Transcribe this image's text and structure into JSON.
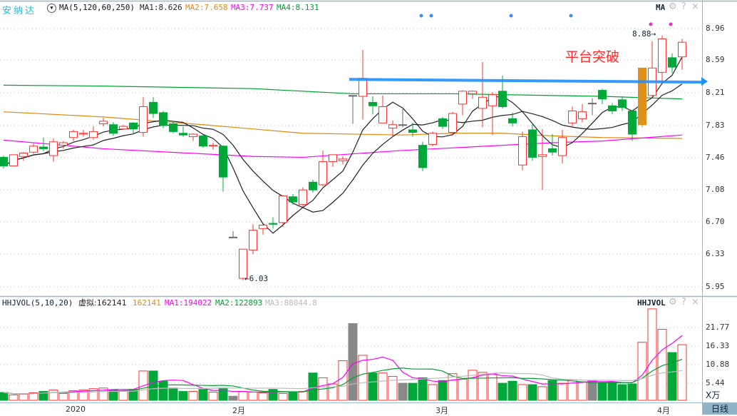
{
  "header": {
    "stock_name": "安纳达",
    "ma_params": "MA(5,120,60,250)",
    "ma1": "MA1:8.626",
    "ma2": "MA2:7.658",
    "ma3": "MA3:7.737",
    "ma4": "MA4:8.131",
    "indicator_name": "MA"
  },
  "volume_header": {
    "params": "HHJVOL(5,10,20)",
    "virtual": "虚拟:162141",
    "value": "162141",
    "ma1": "MA1:194022",
    "ma2": "MA2:122893",
    "ma3": "MA3:88044.8",
    "indicator_name": "HHJVOL",
    "unit": "X万"
  },
  "icons": {
    "settings": "gear-icon",
    "help": "?",
    "close": "×",
    "dropdown": "▼"
  },
  "annotation": "平台突破",
  "high_label": "8.88→",
  "low_label": "←6.03",
  "price_axis": [
    "8.96",
    "8.59",
    "8.21",
    "7.83",
    "7.46",
    "7.08",
    "6.70",
    "6.33",
    "5.95"
  ],
  "volume_axis": [
    "21.77",
    "16.33",
    "10.88",
    "5.44"
  ],
  "x_axis": [
    "2020",
    "2月",
    "3月",
    "4月"
  ],
  "period_button": "日线",
  "colors": {
    "up": "#ff3232",
    "down": "#00a83a",
    "ma1": "#222222",
    "ma2": "#e08a10",
    "ma3": "#ff00ff",
    "ma4": "#00a030",
    "arrow": "#1e90ff",
    "highlight": "#e0901a"
  },
  "chart_data": {
    "type": "candlestick",
    "ohlc": [
      [
        7.46,
        7.36,
        7.48,
        7.33
      ],
      [
        7.36,
        7.49,
        7.49,
        7.36
      ],
      [
        7.47,
        7.51,
        7.52,
        7.42
      ],
      [
        7.52,
        7.59,
        7.62,
        7.5
      ],
      [
        7.58,
        7.56,
        7.69,
        7.53
      ],
      [
        7.48,
        7.64,
        7.68,
        7.41
      ],
      [
        7.6,
        7.63,
        7.65,
        7.56
      ],
      [
        7.69,
        7.76,
        7.78,
        7.65
      ],
      [
        7.73,
        7.74,
        7.78,
        7.7
      ],
      [
        7.69,
        7.76,
        7.82,
        7.66
      ],
      [
        7.85,
        7.88,
        7.92,
        7.82
      ],
      [
        7.84,
        7.74,
        7.87,
        7.71
      ],
      [
        7.79,
        7.82,
        7.84,
        7.78
      ],
      [
        7.86,
        7.79,
        7.87,
        7.73
      ],
      [
        7.75,
        8.05,
        8.16,
        7.7
      ],
      [
        8.1,
        7.97,
        8.16,
        7.92
      ],
      [
        7.98,
        7.83,
        8.0,
        7.8
      ],
      [
        7.85,
        7.76,
        7.88,
        7.74
      ],
      [
        7.74,
        7.72,
        7.82,
        7.7
      ],
      [
        7.7,
        7.73,
        7.74,
        7.65
      ],
      [
        7.71,
        7.59,
        7.72,
        7.57
      ],
      [
        7.59,
        7.6,
        7.63,
        7.55
      ],
      [
        7.59,
        7.23,
        7.6,
        7.06
      ],
      [
        6.53,
        6.53,
        6.6,
        6.53
      ],
      [
        6.05,
        6.39,
        6.39,
        6.03
      ],
      [
        6.38,
        6.61,
        6.68,
        6.33
      ],
      [
        6.63,
        6.67,
        6.68,
        6.56
      ],
      [
        6.69,
        6.68,
        6.76,
        6.63
      ],
      [
        6.7,
        7.01,
        7.02,
        6.65
      ],
      [
        7.0,
        6.94,
        7.03,
        6.91
      ],
      [
        6.91,
        7.08,
        7.11,
        6.88
      ],
      [
        7.17,
        7.08,
        7.2,
        7.05
      ],
      [
        7.14,
        7.41,
        7.54,
        7.12
      ],
      [
        7.41,
        7.49,
        7.49,
        7.35
      ],
      [
        7.42,
        7.44,
        7.47,
        7.38
      ],
      [
        8.18,
        8.18,
        8.18,
        7.85
      ],
      [
        8.17,
        8.38,
        8.71,
        7.9
      ],
      [
        8.1,
        8.06,
        8.17,
        7.96
      ],
      [
        7.86,
        8.05,
        8.18,
        7.86
      ],
      [
        7.8,
        7.84,
        7.89,
        7.7
      ],
      [
        7.84,
        7.84,
        8.04,
        7.81
      ],
      [
        7.78,
        7.75,
        7.86,
        7.7
      ],
      [
        7.6,
        7.34,
        7.64,
        7.3
      ],
      [
        7.61,
        7.74,
        7.76,
        7.59
      ],
      [
        7.91,
        7.82,
        7.93,
        7.79
      ],
      [
        7.75,
        7.97,
        7.99,
        7.71
      ],
      [
        8.08,
        8.23,
        8.24,
        7.95
      ],
      [
        8.2,
        8.23,
        8.24,
        8.14
      ],
      [
        8.03,
        8.16,
        8.57,
        7.81
      ],
      [
        8.06,
        8.19,
        8.22,
        7.72
      ],
      [
        8.23,
        8.05,
        8.41,
        8.03
      ],
      [
        7.91,
        7.86,
        7.98,
        7.82
      ],
      [
        7.37,
        7.7,
        7.76,
        7.31
      ],
      [
        7.78,
        7.46,
        7.86,
        7.42
      ],
      [
        7.47,
        7.49,
        7.79,
        7.08
      ],
      [
        7.56,
        7.52,
        7.73,
        7.48
      ],
      [
        7.48,
        7.69,
        7.78,
        7.39
      ],
      [
        7.86,
        8.0,
        8.05,
        7.82
      ],
      [
        7.91,
        7.99,
        8.08,
        7.87
      ],
      [
        8.09,
        8.09,
        8.15,
        7.95
      ],
      [
        8.24,
        8.14,
        8.26,
        8.08
      ],
      [
        8.06,
        8.0,
        8.09,
        7.96
      ],
      [
        8.13,
        8.04,
        8.17,
        8.0
      ],
      [
        8.0,
        7.73,
        8.01,
        7.65
      ],
      [
        7.84,
        8.5,
        8.5,
        7.81
      ],
      [
        8.18,
        8.5,
        8.81,
        8.17
      ],
      [
        8.45,
        8.84,
        8.88,
        8.31
      ],
      [
        8.62,
        8.51,
        8.67,
        8.44
      ],
      [
        8.63,
        8.8,
        8.84,
        8.48
      ]
    ],
    "highlight_index": 64,
    "volume": [
      2.3,
      1.6,
      1.8,
      2.2,
      2.6,
      3.0,
      2.0,
      2.8,
      3.0,
      3.4,
      3.6,
      3.0,
      2.8,
      3.2,
      8.6,
      8.6,
      5.6,
      3.6,
      2.6,
      2.6,
      3.2,
      2.4,
      3.6,
      1.2,
      2.6,
      2.4,
      2.2,
      3.2,
      2.0,
      2.4,
      2.6,
      8.0,
      6.6,
      4.8,
      11.6,
      22.5,
      13.2,
      8.0,
      8.0,
      7.0,
      5.0,
      5.0,
      6.6,
      4.6,
      5.8,
      7.8,
      6.2,
      8.8,
      8.2,
      7.8,
      5.0,
      5.6,
      4.6,
      4.6,
      4.0,
      5.8,
      5.0,
      6.0,
      5.4,
      5.8,
      5.0,
      5.4,
      4.6,
      4.8,
      17.0,
      26.8,
      20.8,
      14.0,
      16.3
    ],
    "ma120": [
      [
        0,
        7.99
      ],
      [
        10,
        7.93
      ],
      [
        20,
        7.84
      ],
      [
        30,
        7.74
      ],
      [
        40,
        7.72
      ],
      [
        45,
        7.74
      ],
      [
        50,
        7.74
      ],
      [
        55,
        7.71
      ],
      [
        60,
        7.69
      ],
      [
        68,
        7.68
      ]
    ],
    "ma60": [
      [
        0,
        7.66
      ],
      [
        10,
        7.56
      ],
      [
        20,
        7.5
      ],
      [
        25,
        7.47
      ],
      [
        30,
        7.46
      ],
      [
        40,
        7.54
      ],
      [
        50,
        7.6
      ],
      [
        55,
        7.63
      ],
      [
        60,
        7.65
      ],
      [
        68,
        7.72
      ]
    ],
    "ma250": [
      [
        0,
        8.3
      ],
      [
        10,
        8.29
      ],
      [
        20,
        8.27
      ],
      [
        25,
        8.26
      ],
      [
        35,
        8.2
      ],
      [
        45,
        8.2
      ],
      [
        50,
        8.19
      ],
      [
        60,
        8.17
      ],
      [
        68,
        8.14
      ]
    ],
    "breakout_level": 8.36,
    "price_range": [
      5.95,
      8.96
    ],
    "volume_unit": "万"
  }
}
